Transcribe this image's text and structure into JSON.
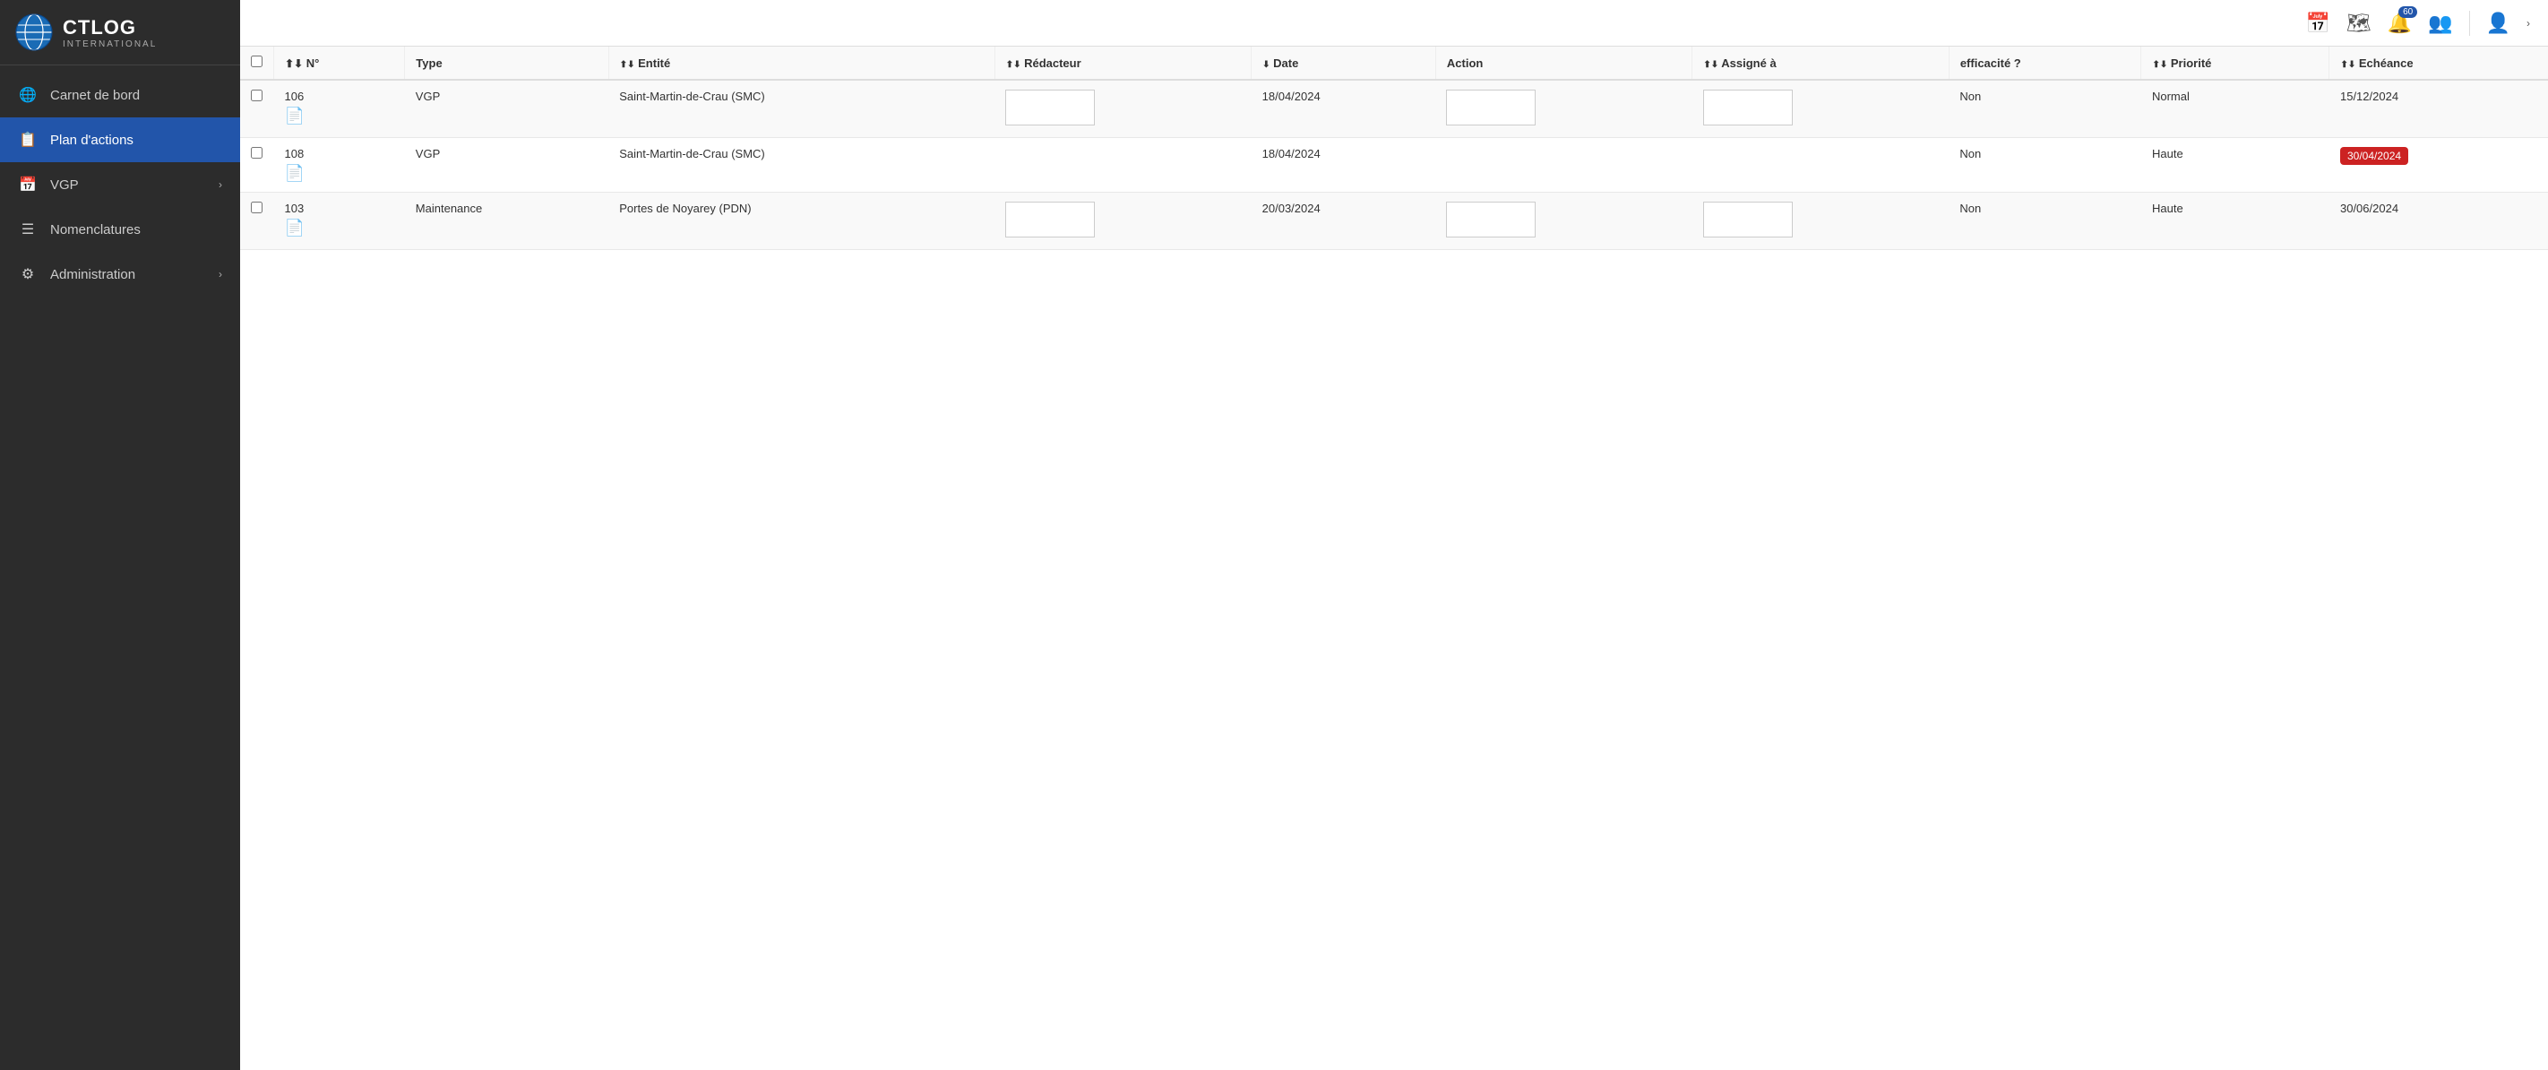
{
  "logo": {
    "title": "CTLOG",
    "subtitle": "INTERNATIONAL"
  },
  "sidebar": {
    "items": [
      {
        "id": "carnet-de-bord",
        "label": "Carnet de bord",
        "icon": "🌐",
        "active": false,
        "hasArrow": false
      },
      {
        "id": "plan-actions",
        "label": "Plan d'actions",
        "icon": "📋",
        "active": true,
        "hasArrow": false
      },
      {
        "id": "vgp",
        "label": "VGP",
        "icon": "📅",
        "active": false,
        "hasArrow": true
      },
      {
        "id": "nomenclatures",
        "label": "Nomenclatures",
        "icon": "☰",
        "active": false,
        "hasArrow": false
      },
      {
        "id": "administration",
        "label": "Administration",
        "icon": "⚙",
        "active": false,
        "hasArrow": true
      }
    ]
  },
  "header": {
    "notification_count": "60",
    "icons": [
      "calendar",
      "map",
      "bell",
      "users",
      "user",
      "chevron"
    ]
  },
  "table": {
    "columns": [
      {
        "id": "checkbox",
        "label": ""
      },
      {
        "id": "num",
        "label": "N°",
        "sortable": true
      },
      {
        "id": "type",
        "label": "Type",
        "sortable": false
      },
      {
        "id": "entite",
        "label": "Entité",
        "sortable": true
      },
      {
        "id": "redacteur",
        "label": "Rédacteur",
        "sortable": true
      },
      {
        "id": "date",
        "label": "Date",
        "sortable": true
      },
      {
        "id": "action",
        "label": "Action",
        "sortable": false
      },
      {
        "id": "assigne",
        "label": "Assigné à",
        "sortable": true
      },
      {
        "id": "efficacite",
        "label": "efficacité ?",
        "sortable": false
      },
      {
        "id": "priorite",
        "label": "Priorité",
        "sortable": true
      },
      {
        "id": "echeance",
        "label": "Echéance",
        "sortable": true
      }
    ],
    "rows": [
      {
        "num": "106",
        "type": "VGP",
        "entite": "Saint-Martin-de-Crau (SMC)",
        "redacteur": "",
        "date": "18/04/2024",
        "action": "",
        "assigne": "",
        "efficacite": "Non",
        "priorite": "Normal",
        "echeance": "15/12/2024",
        "echeance_badge": false,
        "has_input_redacteur": true,
        "has_input_action": true,
        "has_input_assigne": true
      },
      {
        "num": "108",
        "type": "VGP",
        "entite": "Saint-Martin-de-Crau (SMC)",
        "redacteur": "",
        "date": "18/04/2024",
        "action": "",
        "assigne": "",
        "efficacite": "Non",
        "priorite": "Haute",
        "echeance": "30/04/2024",
        "echeance_badge": true,
        "has_input_redacteur": false,
        "has_input_action": false,
        "has_input_assigne": false
      },
      {
        "num": "103",
        "type": "Maintenance",
        "entite": "Portes de Noyarey (PDN)",
        "redacteur": "",
        "date": "20/03/2024",
        "action": "",
        "assigne": "",
        "efficacite": "Non",
        "priorite": "Haute",
        "echeance": "30/06/2024",
        "echeance_badge": false,
        "has_input_redacteur": true,
        "has_input_action": true,
        "has_input_assigne": true
      }
    ]
  }
}
